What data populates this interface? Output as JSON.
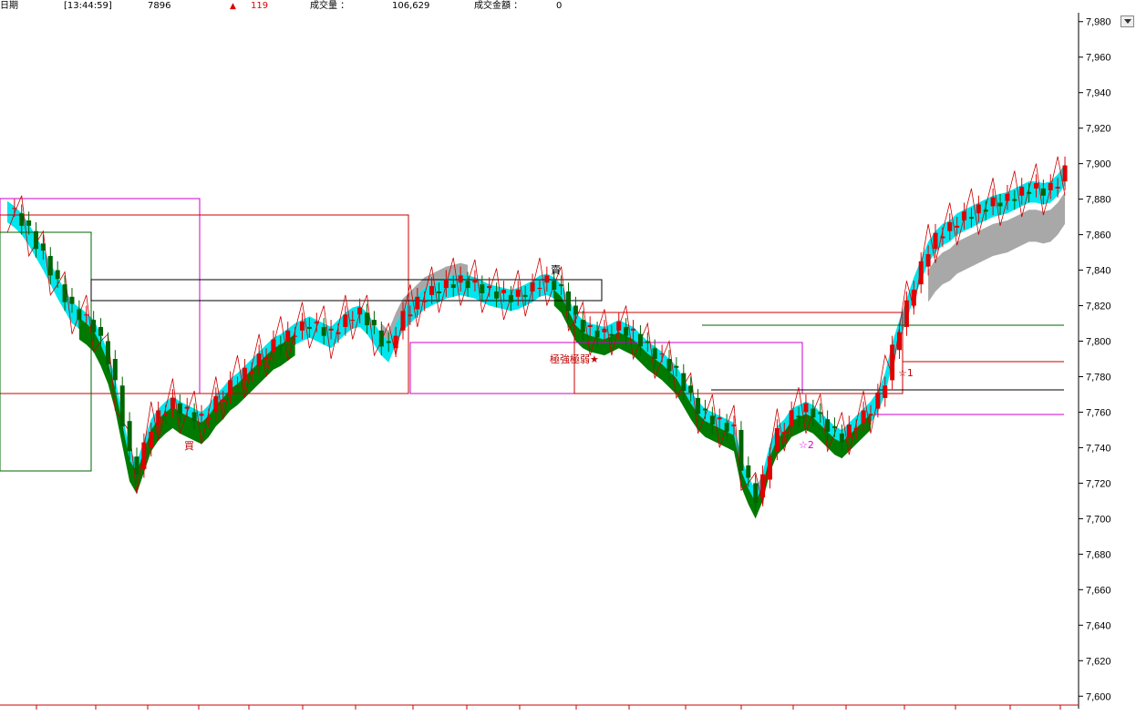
{
  "header": {
    "label_date": "日期",
    "time": "[13:44:59]",
    "price": "7896",
    "change_icon": "up-triangle",
    "change": "119",
    "volume_label": "成交量 ：",
    "volume": "106,629",
    "amount_label": "成交金額 ：",
    "amount": "0"
  },
  "colors": {
    "up": "#e00000",
    "down": "#006400",
    "cloud_cyan": "#00e5ee",
    "cloud_green": "#007a00",
    "cloud_gray": "#a8a8a8",
    "annotation_red": "#c00000",
    "annotation_magenta": "#e000e0"
  },
  "annotations": [
    {
      "text": "極強極弱★",
      "color": "#c00000"
    },
    {
      "text": "賣",
      "color": "#000000"
    },
    {
      "text": "買",
      "color": "#c00000"
    },
    {
      "text": "☆2",
      "color": "#e000e0"
    },
    {
      "text": "☆1",
      "color": "#c00000"
    }
  ],
  "chart_data": {
    "type": "candlestick",
    "title": "",
    "xlabel": "",
    "ylabel": "",
    "ylim": [
      7595,
      7985
    ],
    "yticks": [
      "7,980",
      "7,960",
      "7,940",
      "7,920",
      "7,900",
      "7,880",
      "7,860",
      "7,840",
      "7,820",
      "7,800",
      "7,780",
      "7,760",
      "7,740",
      "7,720",
      "7,700",
      "7,680",
      "7,660",
      "7,640",
      "7,620",
      "7,600"
    ],
    "ytick_values": [
      7980,
      7960,
      7940,
      7920,
      7900,
      7880,
      7860,
      7840,
      7820,
      7800,
      7780,
      7760,
      7740,
      7720,
      7700,
      7680,
      7660,
      7640,
      7620,
      7600
    ],
    "close_path": [
      7875,
      7872,
      7868,
      7862,
      7855,
      7848,
      7840,
      7832,
      7825,
      7818,
      7815,
      7812,
      7808,
      7800,
      7790,
      7775,
      7755,
      7735,
      7728,
      7740,
      7752,
      7758,
      7762,
      7765,
      7762,
      7760,
      7758,
      7756,
      7760,
      7766,
      7770,
      7775,
      7778,
      7782,
      7786,
      7790,
      7794,
      7798,
      7800,
      7803,
      7806,
      7808,
      7810,
      7808,
      7806,
      7804,
      7808,
      7812,
      7815,
      7816,
      7812,
      7806,
      7800,
      7796,
      7806,
      7814,
      7818,
      7822,
      7826,
      7828,
      7830,
      7832,
      7833,
      7834,
      7833,
      7832,
      7830,
      7828,
      7827,
      7826,
      7825,
      7826,
      7828,
      7830,
      7833,
      7834,
      7832,
      7828,
      7820,
      7812,
      7808,
      7806,
      7805,
      7804,
      7806,
      7808,
      7806,
      7804,
      7800,
      7796,
      7793,
      7790,
      7786,
      7782,
      7775,
      7768,
      7762,
      7758,
      7756,
      7754,
      7752,
      7750,
      7730,
      7720,
      7712,
      7722,
      7738,
      7748,
      7752,
      7758,
      7760,
      7762,
      7760,
      7756,
      7752,
      7748,
      7746,
      7750,
      7754,
      7758,
      7762,
      7768,
      7778,
      7795,
      7808,
      7820,
      7832,
      7842,
      7852,
      7858,
      7862,
      7864,
      7868,
      7870,
      7872,
      7874,
      7876,
      7878,
      7879,
      7880,
      7882,
      7884,
      7886,
      7886,
      7885,
      7886,
      7890,
      7896
    ]
  }
}
